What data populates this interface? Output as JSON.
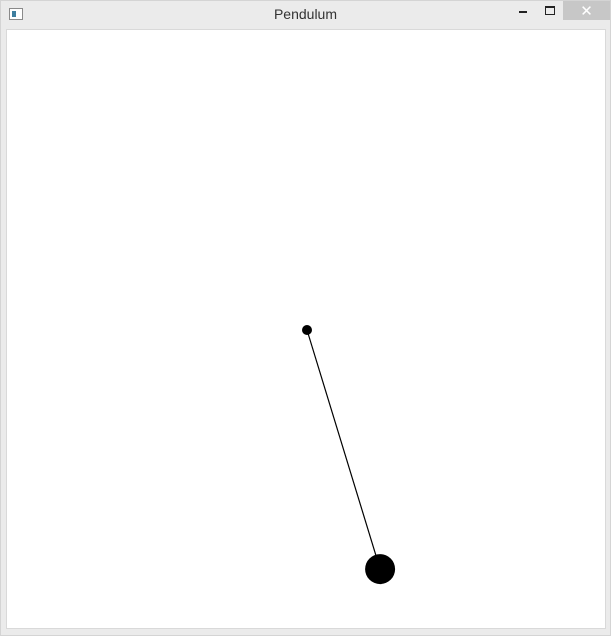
{
  "window": {
    "title": "Pendulum",
    "close_glyph": "✕",
    "icons": {
      "app": "app-window-icon",
      "minimize": "minimize-icon",
      "maximize": "maximize-icon",
      "close": "close-icon"
    }
  },
  "pendulum": {
    "angle_degrees": 17,
    "colors": {
      "rod": "#000000",
      "bob": "#000000",
      "pivot": "#000000",
      "background": "#ffffff"
    }
  }
}
